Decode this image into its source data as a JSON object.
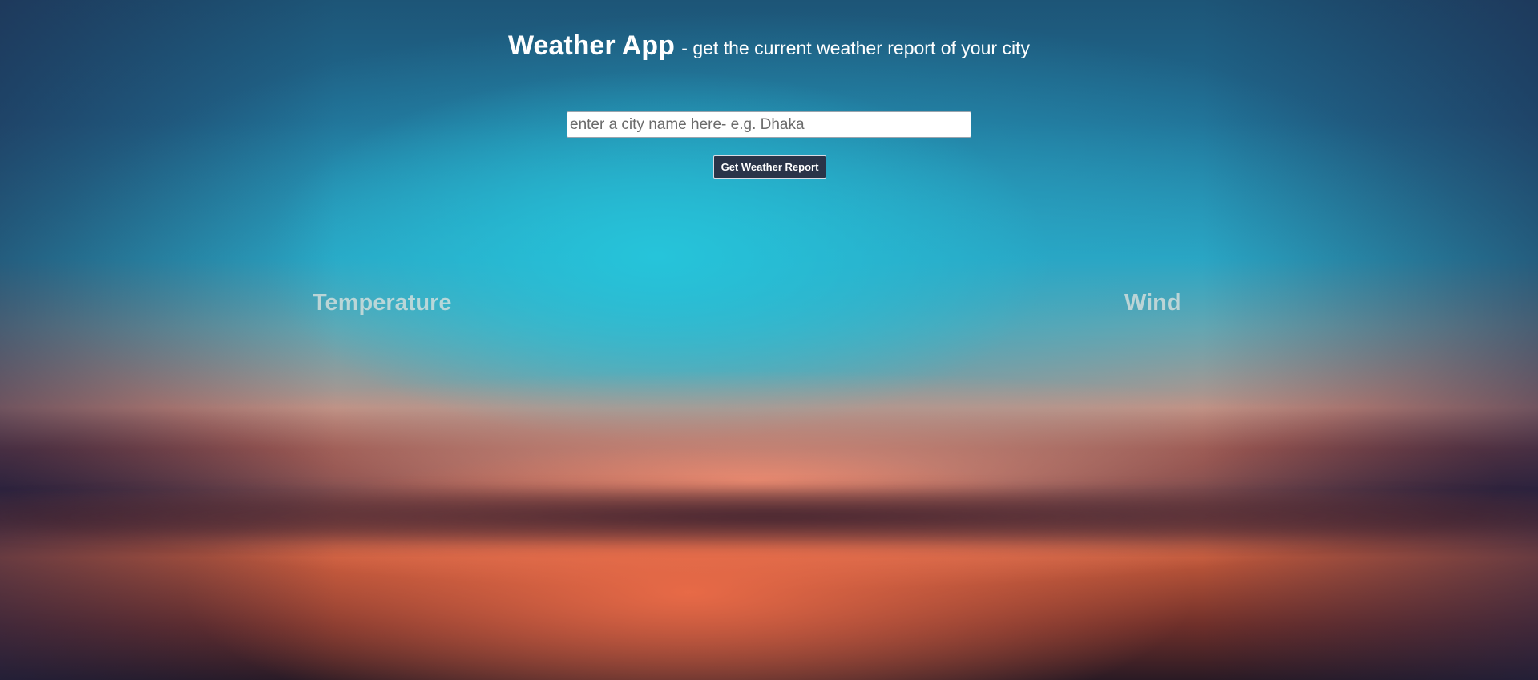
{
  "header": {
    "title": "Weather App",
    "subtitle": "- get the current weather report of your city"
  },
  "search": {
    "value": "",
    "placeholder": "enter a city name here- e.g. Dhaka"
  },
  "actions": {
    "get_report_label": "Get Weather Report"
  },
  "sections": {
    "temperature_label": "Temperature",
    "wind_label": "Wind"
  },
  "colors": {
    "button_bg": "#2a3448",
    "text_white": "#ffffff",
    "section_label": "#dce2de"
  }
}
